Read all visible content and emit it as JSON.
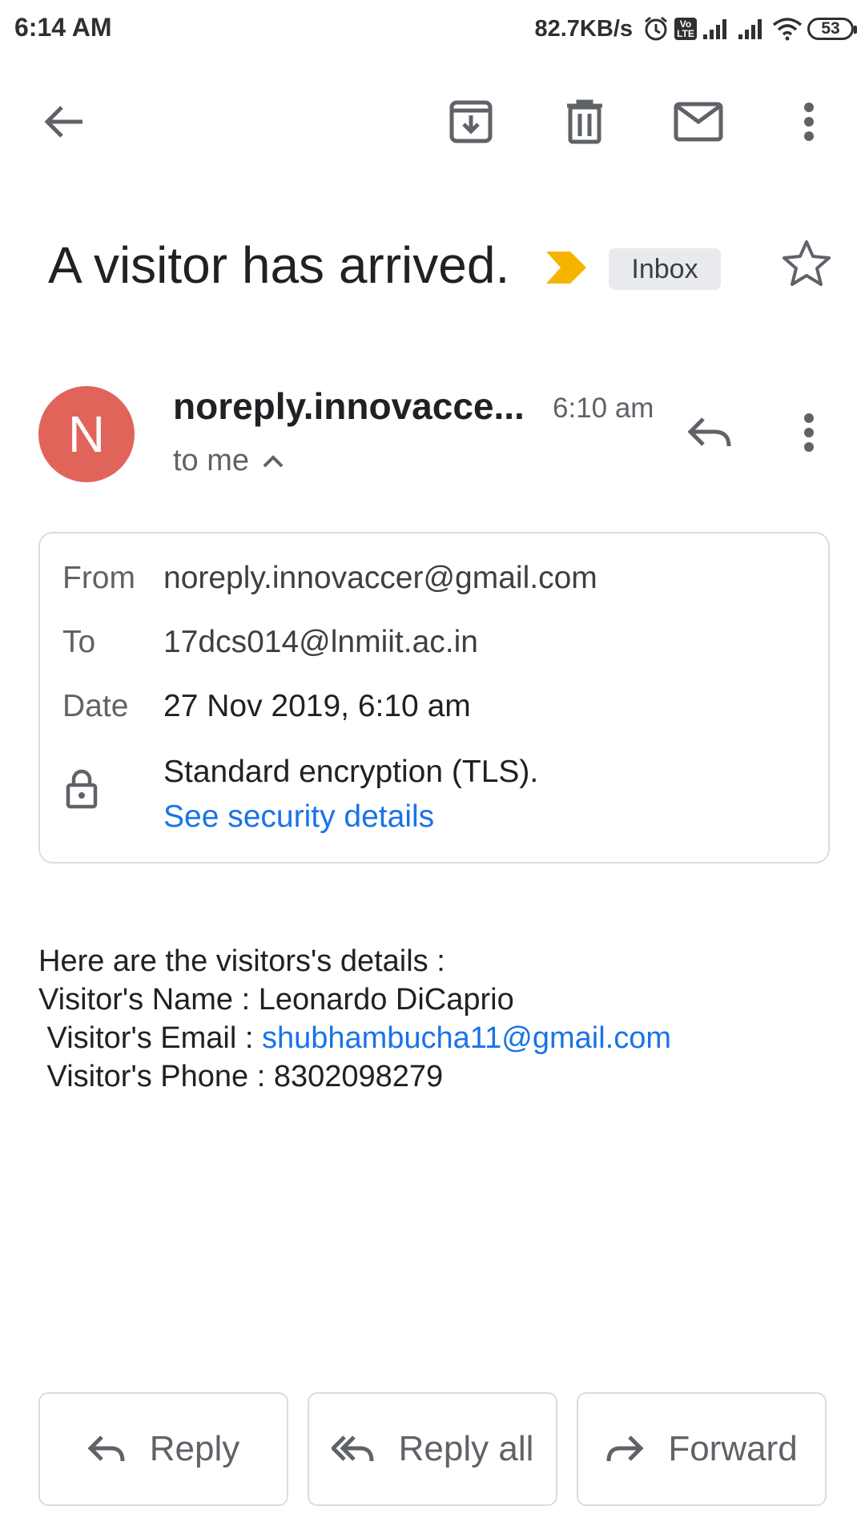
{
  "status_bar": {
    "time": "6:14 AM",
    "network_speed": "82.7KB/s",
    "volte_badge": "Vo LTE",
    "battery": "53",
    "icons": [
      "alarm-icon",
      "volte-icon",
      "signal-icon",
      "signal-icon",
      "wifi-icon",
      "battery-icon"
    ]
  },
  "toolbar": {
    "icons": [
      "back-arrow-icon",
      "archive-icon",
      "delete-icon",
      "mark-unread-icon",
      "more-vert-icon"
    ]
  },
  "email": {
    "subject": "A visitor has arrived.",
    "importance_color": "#f6b400",
    "label": "Inbox",
    "sender_initial": "N",
    "avatar_color": "#e1645a",
    "sender_name": "noreply.innovacce...",
    "time": "6:10 am",
    "recipient_line": "to me"
  },
  "details": {
    "from_label": "From",
    "from_value": "noreply.innovaccer@gmail.com",
    "to_label": "To",
    "to_value": "17dcs014@lnmiit.ac.in",
    "date_label": "Date",
    "date_value": "27 Nov 2019, 6:10 am",
    "encryption": "Standard encryption (TLS).",
    "security_link": "See security details"
  },
  "body": {
    "intro": "Here are the visitors's details :",
    "name_line": "Visitor's Name : Leonardo DiCaprio",
    "email_prefix": " Visitor's Email : ",
    "email_link": "shubhambucha11@gmail.com",
    "phone_line": " Visitor's Phone : 8302098279"
  },
  "actions": {
    "reply": "Reply",
    "reply_all": "Reply all",
    "forward": "Forward"
  },
  "colors": {
    "link": "#1a73e8",
    "icon": "#5f6368"
  }
}
